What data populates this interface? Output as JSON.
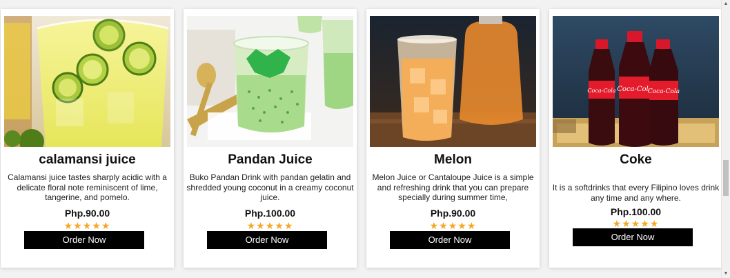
{
  "products": [
    {
      "name": "calamansi juice",
      "description": "Calamansi juice tastes sharply acidic with a delicate floral note reminiscent of lime, tangerine, and pomelo.",
      "price": "Php.90.00",
      "rating": 5,
      "button": "Order Now",
      "image": "calamansi-juice-photo"
    },
    {
      "name": "Pandan Juice",
      "description": "Buko Pandan Drink with pandan gelatin and shredded young coconut in a creamy coconut juice.",
      "price": "Php.100.00",
      "rating": 5,
      "button": "Order Now",
      "image": "pandan-juice-photo"
    },
    {
      "name": "Melon",
      "description": "Melon Juice or Cantaloupe Juice is a simple and refreshing drink that you can prepare specially during summer time,",
      "price": "Php.90.00",
      "rating": 5,
      "button": "Order Now",
      "image": "melon-juice-photo"
    },
    {
      "name": "Coke",
      "description": "It is a softdrinks that every Filipino loves drink any time and any where.",
      "price": "Php.100.00",
      "rating": 5,
      "button": "Order Now",
      "image": "coke-bottles-photo"
    }
  ],
  "stars_text": "★★★★★",
  "colors": {
    "star": "#f5a623",
    "button_bg": "#000000",
    "button_text": "#ffffff"
  }
}
